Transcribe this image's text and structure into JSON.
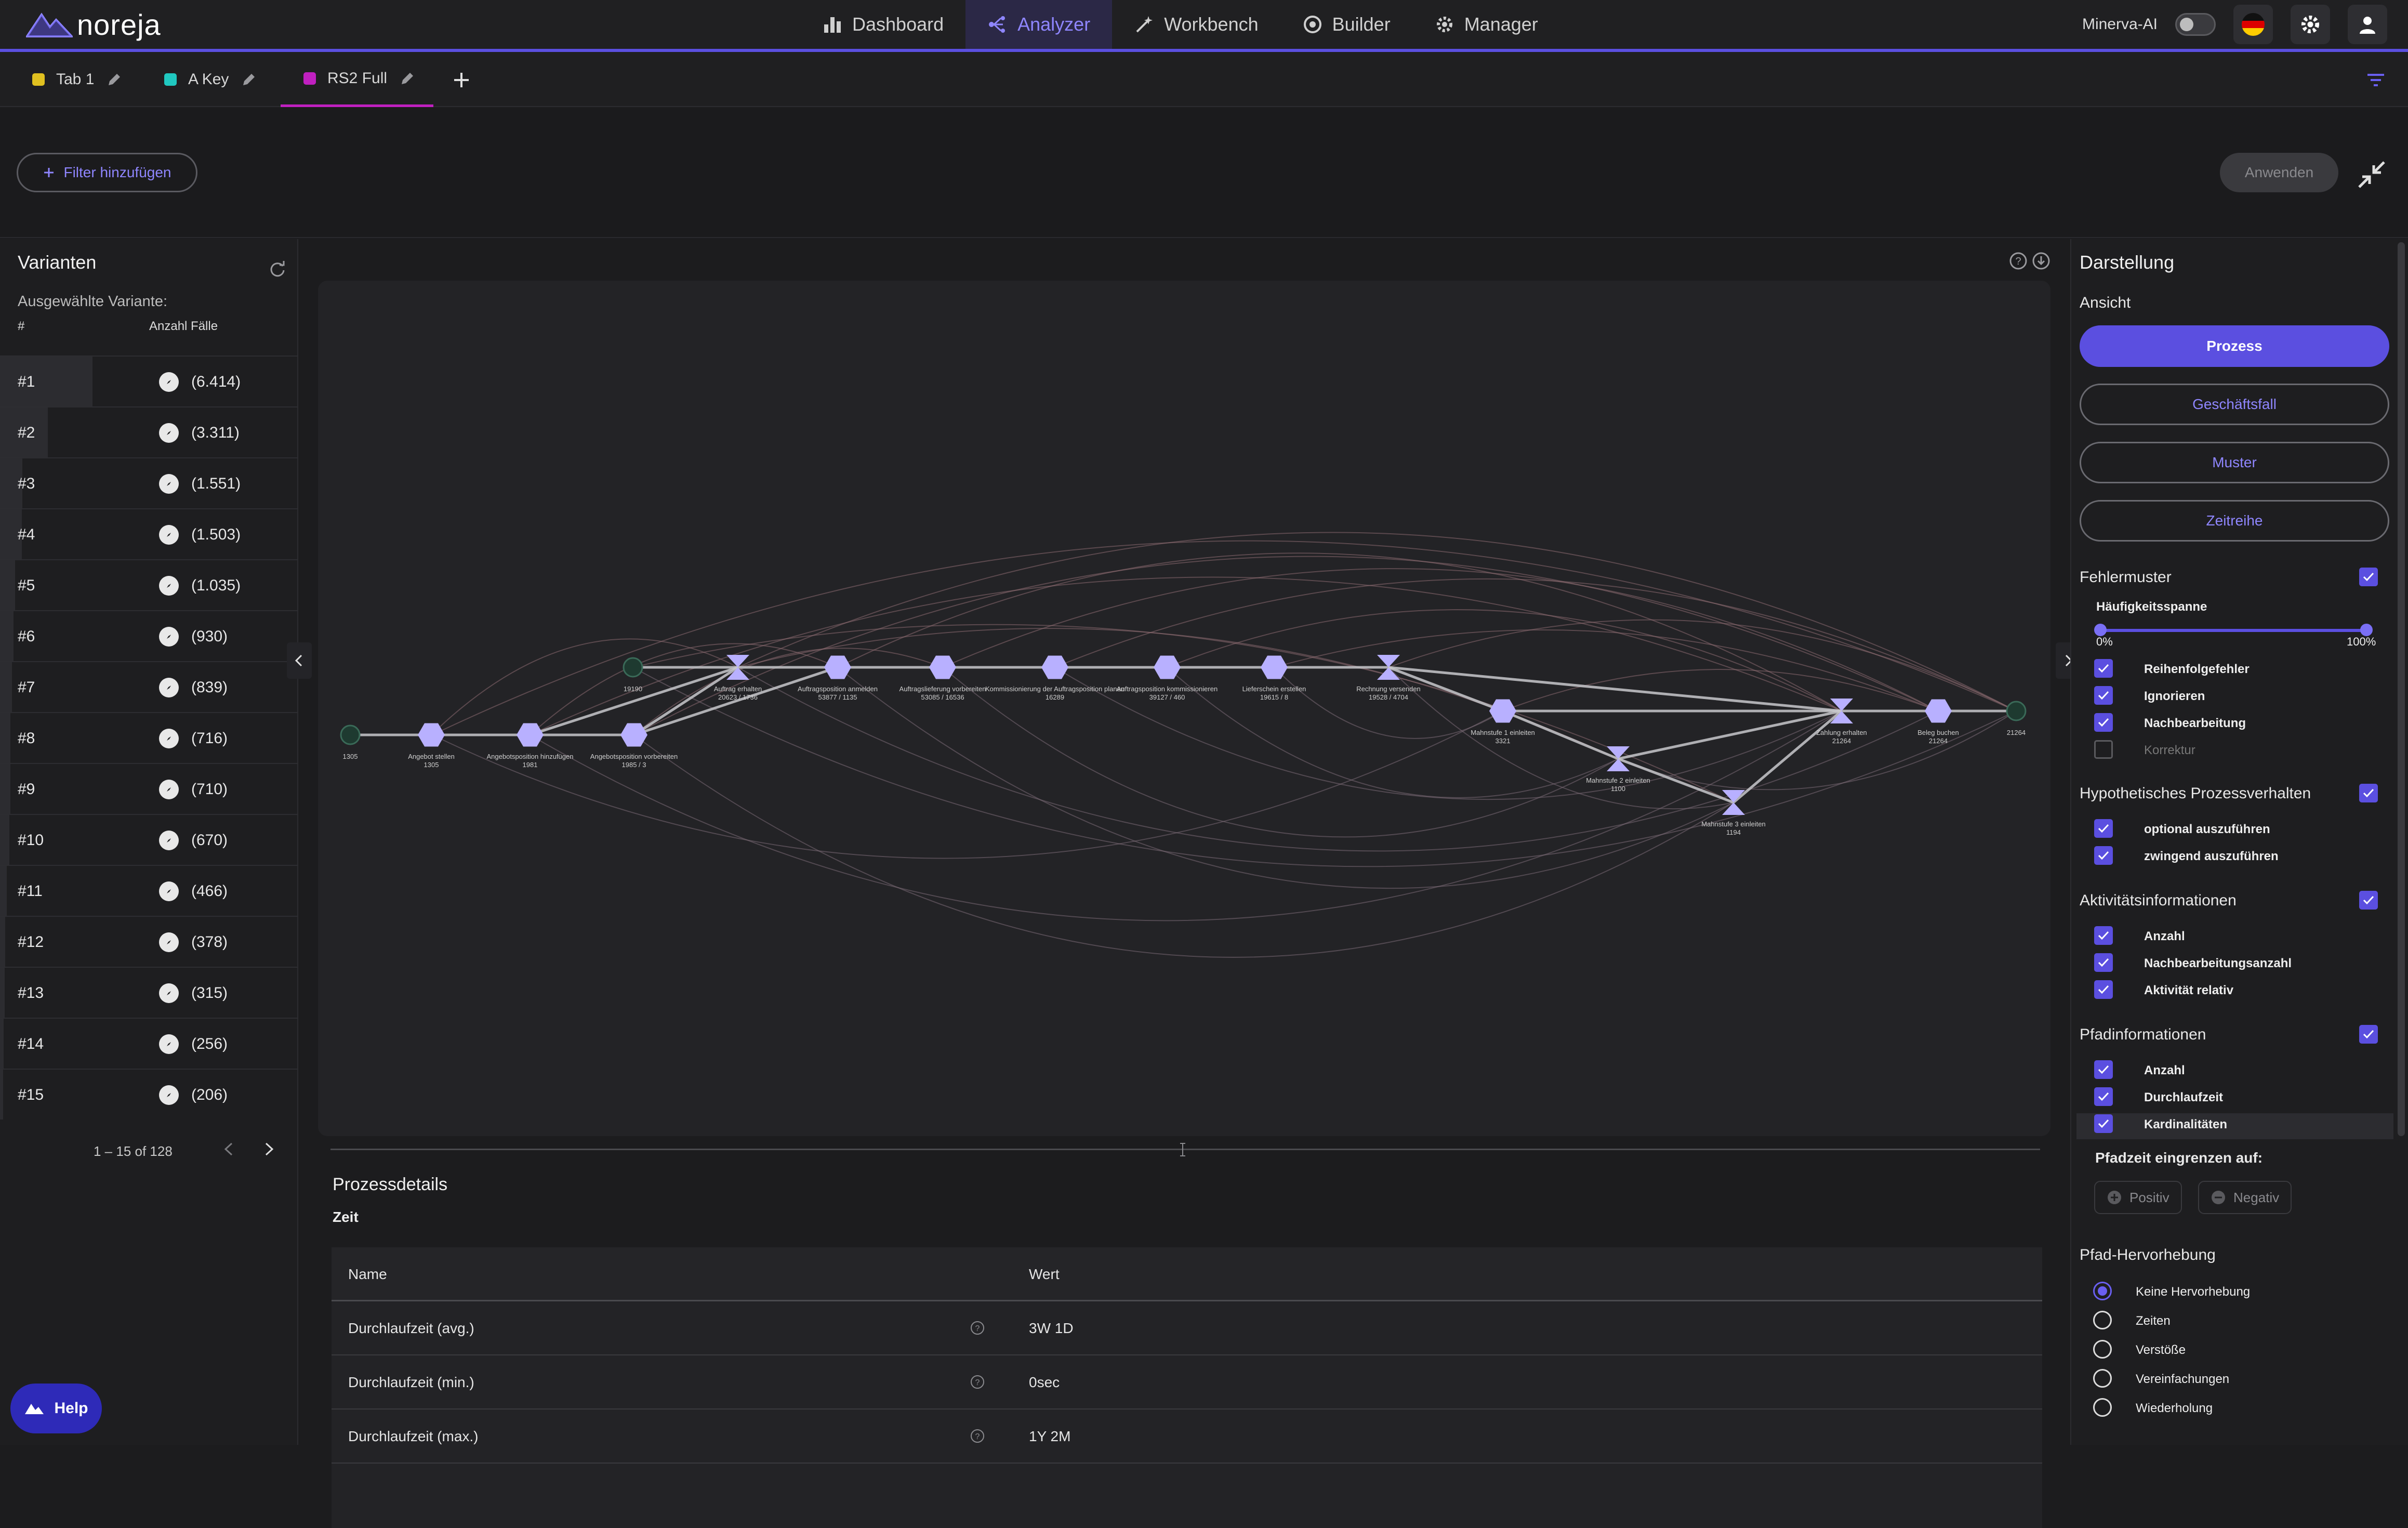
{
  "brand": "noreja",
  "nav": [
    {
      "label": "Dashboard",
      "icon": "bar-chart-icon",
      "active": false
    },
    {
      "label": "Analyzer",
      "icon": "process-flow-icon",
      "active": true
    },
    {
      "label": "Workbench",
      "icon": "magic-wand-icon",
      "active": false
    },
    {
      "label": "Builder",
      "icon": "builder-icon",
      "active": false
    },
    {
      "label": "Manager",
      "icon": "gear-icon",
      "active": false
    }
  ],
  "topbar": {
    "minerva_label": "Minerva-AI",
    "minerva_on": false
  },
  "tabs": [
    {
      "label": "Tab 1",
      "color": "#e0c020"
    },
    {
      "label": "A Key",
      "color": "#20c8c0"
    },
    {
      "label": "RS2 Full",
      "color": "#c020c0"
    }
  ],
  "filter": {
    "add_label": "Filter hinzufügen",
    "apply_label": "Anwenden"
  },
  "variants": {
    "title": "Varianten",
    "selected_label": "Ausgewählte Variante:",
    "col_hash": "#",
    "col_count": "Anzahl Fälle",
    "rows": [
      {
        "num": "#1",
        "count": "(6.414)",
        "share": 0.31
      },
      {
        "num": "#2",
        "count": "(3.311)",
        "share": 0.16
      },
      {
        "num": "#3",
        "count": "(1.551)",
        "share": 0.075
      },
      {
        "num": "#4",
        "count": "(1.503)",
        "share": 0.073
      },
      {
        "num": "#5",
        "count": "(1.035)",
        "share": 0.05
      },
      {
        "num": "#6",
        "count": "(930)",
        "share": 0.045
      },
      {
        "num": "#7",
        "count": "(839)",
        "share": 0.04
      },
      {
        "num": "#8",
        "count": "(716)",
        "share": 0.035
      },
      {
        "num": "#9",
        "count": "(710)",
        "share": 0.034
      },
      {
        "num": "#10",
        "count": "(670)",
        "share": 0.032
      },
      {
        "num": "#11",
        "count": "(466)",
        "share": 0.022
      },
      {
        "num": "#12",
        "count": "(378)",
        "share": 0.018
      },
      {
        "num": "#13",
        "count": "(315)",
        "share": 0.015
      },
      {
        "num": "#14",
        "count": "(256)",
        "share": 0.012
      },
      {
        "num": "#15",
        "count": "(206)",
        "share": 0.01
      }
    ],
    "pager": "1 – 15 of 128"
  },
  "help_label": "Help",
  "graph": {
    "nodes": [
      {
        "label": "1305",
        "sub": ""
      },
      {
        "label": "Angebot stellen",
        "sub": "1305"
      },
      {
        "label": "Angebotsposition hinzufügen",
        "sub": "1981"
      },
      {
        "label": "Angebotsposition vorbereiten",
        "sub": "1985 / 3"
      },
      {
        "label": "19190",
        "sub": ""
      },
      {
        "label": "Auftrag erhalten",
        "sub": "20623 / 1736"
      },
      {
        "label": "Auftragsposition anmelden",
        "sub": "53877 / 1135"
      },
      {
        "label": "Auftragslieferung vorbereiten",
        "sub": "53085 / 16536"
      },
      {
        "label": "Kommissionierung der Auftragsposition planen",
        "sub": "16289"
      },
      {
        "label": "Auftragsposition kommissionieren",
        "sub": "39127 / 460"
      },
      {
        "label": "Lieferschein erstellen",
        "sub": "19615 / 8"
      },
      {
        "label": "Rechnung versenden",
        "sub": "19528 / 4704"
      },
      {
        "label": "Mahnstufe 1 einleiten",
        "sub": "3321"
      },
      {
        "label": "Mahnstufe 2 einleiten",
        "sub": "1100"
      },
      {
        "label": "Mahnstufe 3 einleiten",
        "sub": "1194"
      },
      {
        "label": "Zahlung erhalten",
        "sub": "21264"
      },
      {
        "label": "Beleg buchen",
        "sub": "21264"
      },
      {
        "label": "21264",
        "sub": ""
      }
    ]
  },
  "details": {
    "title": "Prozessdetails",
    "subtitle": "Zeit",
    "col_name": "Name",
    "col_value": "Wert",
    "rows": [
      {
        "name": "Durchlaufzeit (avg.)",
        "value": "3W 1D"
      },
      {
        "name": "Durchlaufzeit (min.)",
        "value": "0sec"
      },
      {
        "name": "Durchlaufzeit (max.)",
        "value": "1Y 2M"
      }
    ]
  },
  "settings": {
    "title": "Darstellung",
    "view_label": "Ansicht",
    "views": [
      "Prozess",
      "Geschäftsfall",
      "Muster",
      "Zeitreihe"
    ],
    "fehlermuster": {
      "label": "Fehlermuster",
      "range_label": "Häufigkeitsspanne",
      "min": "0%",
      "max": "100%",
      "items": [
        {
          "label": "Reihenfolgefehler",
          "checked": true
        },
        {
          "label": "Ignorieren",
          "checked": true
        },
        {
          "label": "Nachbearbeitung",
          "checked": true
        },
        {
          "label": "Korrektur",
          "checked": false
        }
      ]
    },
    "hypo": {
      "label": "Hypothetisches Prozessverhalten",
      "items": [
        {
          "label": "optional auszuführen",
          "checked": true
        },
        {
          "label": "zwingend auszuführen",
          "checked": true
        }
      ]
    },
    "activity": {
      "label": "Aktivitätsinformationen",
      "items": [
        {
          "label": "Anzahl",
          "checked": true
        },
        {
          "label": "Nachbearbeitungsanzahl",
          "checked": true
        },
        {
          "label": "Aktivität relativ",
          "checked": true
        }
      ]
    },
    "path": {
      "label": "Pfadinformationen",
      "items": [
        {
          "label": "Anzahl",
          "checked": true
        },
        {
          "label": "Durchlaufzeit",
          "checked": true
        },
        {
          "label": "Kardinalitäten",
          "checked": true
        }
      ],
      "limit_label": "Pfadzeit eingrenzen auf:",
      "positive": "Positiv",
      "negative": "Negativ"
    },
    "highlight": {
      "label": "Pfad-Hervorhebung",
      "options": [
        "Keine Hervorhebung",
        "Zeiten",
        "Verstöße",
        "Vereinfachungen",
        "Wiederholung"
      ],
      "selected": 0
    }
  }
}
